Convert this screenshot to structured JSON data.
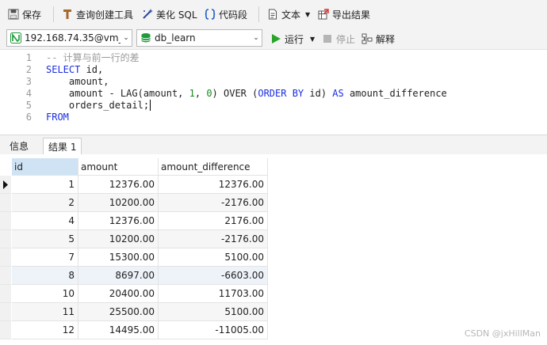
{
  "toolbar": {
    "save": "保存",
    "query_builder": "查询创建工具",
    "beautify_sql": "美化 SQL",
    "code_snippet": "代码段",
    "text": "文本",
    "export": "导出结果"
  },
  "toolbar2": {
    "connection": "192.168.74.35@vm_",
    "database": "db_learn",
    "run": "运行",
    "stop": "停止",
    "explain": "解释"
  },
  "editor": {
    "lines": [
      {
        "num": "1",
        "segments": [
          {
            "t": "-- 计算与前一行的差",
            "c": "cm"
          }
        ]
      },
      {
        "num": "2",
        "segments": [
          {
            "t": "SELECT",
            "c": "kw"
          },
          {
            "t": " id,",
            "c": ""
          }
        ]
      },
      {
        "num": "3",
        "segments": [
          {
            "t": "    amount,",
            "c": ""
          }
        ]
      },
      {
        "num": "4",
        "segments": [
          {
            "t": "    amount - LAG(amount, ",
            "c": ""
          },
          {
            "t": "1",
            "c": "nm"
          },
          {
            "t": ", ",
            "c": ""
          },
          {
            "t": "0",
            "c": "nm"
          },
          {
            "t": ") OVER (",
            "c": ""
          },
          {
            "t": "ORDER BY",
            "c": "kw"
          },
          {
            "t": " id) ",
            "c": ""
          },
          {
            "t": "AS",
            "c": "kw"
          },
          {
            "t": " amount_difference",
            "c": ""
          }
        ]
      },
      {
        "num": "5",
        "segments": [
          {
            "t": "    orders_detail;",
            "c": ""
          }
        ]
      },
      {
        "num": "6",
        "segments": [
          {
            "t": "FROM",
            "c": "kw"
          }
        ]
      }
    ]
  },
  "result_tabs": [
    "信息",
    "结果 1"
  ],
  "grid": {
    "columns": [
      "id",
      "amount",
      "amount_difference"
    ],
    "rows": [
      [
        "1",
        "12376.00",
        "12376.00"
      ],
      [
        "2",
        "10200.00",
        "-2176.00"
      ],
      [
        "4",
        "12376.00",
        "2176.00"
      ],
      [
        "5",
        "10200.00",
        "-2176.00"
      ],
      [
        "7",
        "15300.00",
        "5100.00"
      ],
      [
        "8",
        "8697.00",
        "-6603.00"
      ],
      [
        "10",
        "20400.00",
        "11703.00"
      ],
      [
        "11",
        "25500.00",
        "5100.00"
      ],
      [
        "12",
        "14495.00",
        "-11005.00"
      ]
    ]
  },
  "watermark": "CSDN @jxHillMan",
  "colors": {
    "keyword": "#1a2de0",
    "run_green": "#2aa32a",
    "db_green": "#1e9b3a",
    "selected_header": "#cfe3f5"
  }
}
